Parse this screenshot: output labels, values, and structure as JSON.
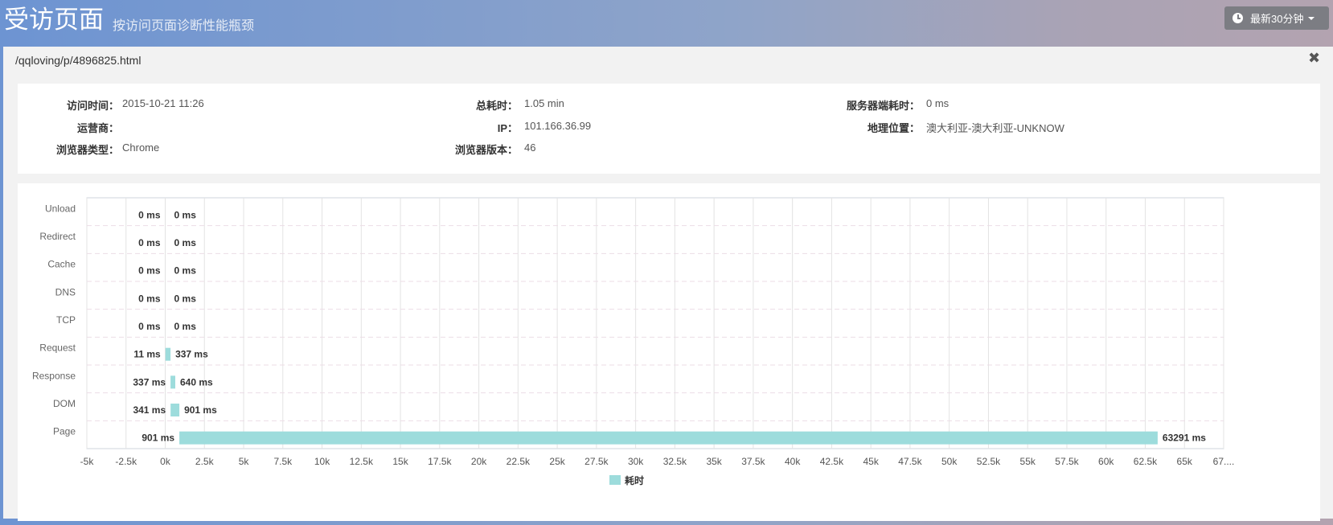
{
  "header": {
    "title": "受访页面",
    "subtitle": "按访问页面诊断性能瓶颈",
    "time_range": "最新30分钟"
  },
  "panel": {
    "url": "/qqloving/p/4896825.html",
    "info": [
      {
        "label": "访问时间：",
        "value": "2015-10-21 11:26"
      },
      {
        "label": "总耗时：",
        "value": "1.05 min"
      },
      {
        "label": "服务器端耗时：",
        "value": "0 ms"
      },
      {
        "label": "运营商：",
        "value": ""
      },
      {
        "label": "IP：",
        "value": "101.166.36.99"
      },
      {
        "label": "地理位置：",
        "value": "澳大利亚-澳大利亚-UNKNOW"
      },
      {
        "label": "浏览器类型：",
        "value": "Chrome"
      },
      {
        "label": "浏览器版本：",
        "value": "46"
      }
    ]
  },
  "colors": {
    "bar": "#9ddcdc",
    "grid": "#e3e3e3"
  },
  "chart_data": {
    "type": "bar",
    "orientation": "horizontal",
    "categories": [
      "Unload",
      "Redirect",
      "Cache",
      "DNS",
      "TCP",
      "Request",
      "Response",
      "DOM",
      "Page"
    ],
    "series": [
      {
        "name": "耗时",
        "ranges": [
          {
            "start": 0,
            "end": 0
          },
          {
            "start": 0,
            "end": 0
          },
          {
            "start": 0,
            "end": 0
          },
          {
            "start": 0,
            "end": 0
          },
          {
            "start": 0,
            "end": 0
          },
          {
            "start": 11,
            "end": 337
          },
          {
            "start": 337,
            "end": 640
          },
          {
            "start": 341,
            "end": 901
          },
          {
            "start": 901,
            "end": 63291
          }
        ],
        "start_labels": [
          "0 ms",
          "0 ms",
          "0 ms",
          "0 ms",
          "0 ms",
          "11 ms",
          "337 ms",
          "341 ms",
          "901 ms"
        ],
        "end_labels": [
          "0 ms",
          "0 ms",
          "0 ms",
          "0 ms",
          "0 ms",
          "337 ms",
          "640 ms",
          "901 ms",
          "63291 ms"
        ]
      }
    ],
    "xlim": [
      -5000,
      67500
    ],
    "xticks": [
      "-5k",
      "-2.5k",
      "0k",
      "2.5k",
      "5k",
      "7.5k",
      "10k",
      "12.5k",
      "15k",
      "17.5k",
      "20k",
      "22.5k",
      "25k",
      "27.5k",
      "30k",
      "32.5k",
      "35k",
      "37.5k",
      "40k",
      "42.5k",
      "45k",
      "47.5k",
      "50k",
      "52.5k",
      "55k",
      "57.5k",
      "60k",
      "62.5k",
      "65k",
      "67...."
    ],
    "grid": true,
    "legend": "bottom-center"
  }
}
